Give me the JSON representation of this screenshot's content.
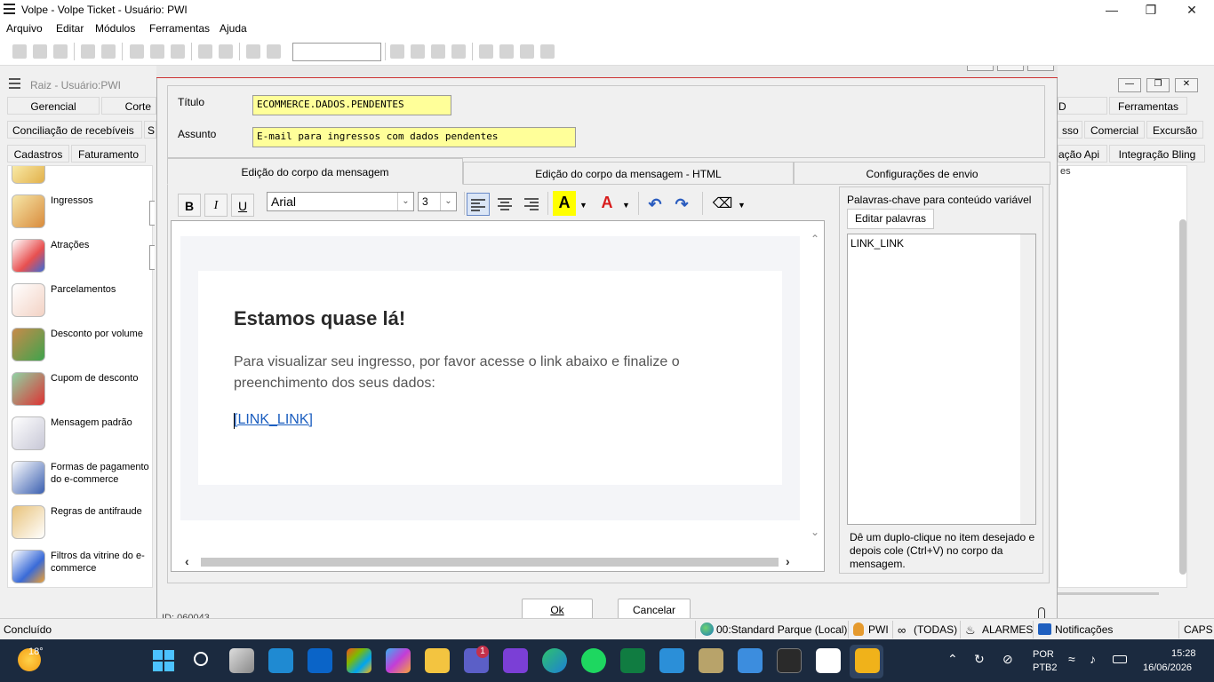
{
  "window": {
    "title": "Volpe - Volpe Ticket - Usuário: PWI"
  },
  "menu": [
    "Arquivo",
    "Editar",
    "Módulos",
    "Ferramentas",
    "Ajuda"
  ],
  "bgwindow": {
    "title": "Raiz - Usuário:PWI",
    "tabs_row1": [
      "Gerencial",
      "Corte",
      "D",
      "Ferramentas"
    ],
    "tabs_row2": [
      "Conciliação de recebíveis",
      "S",
      "sso",
      "Comercial",
      "Excursão"
    ],
    "tabs_row3": [
      "Cadastros",
      "Faturamento",
      "ação Api",
      "Integração Bling"
    ],
    "list": [
      "Ingressos",
      "Atrações",
      "Parcelamentos",
      "Desconto por volume",
      "Cupom de desconto",
      "Mensagem padrão",
      "Formas de pagamento do e-commerce",
      "Regras de antifraude",
      "Filtros da vitrine do e-commerce"
    ],
    "right_text": "es"
  },
  "dialog": {
    "titulo_label": "Título",
    "titulo_value": "ECOMMERCE.DADOS.PENDENTES",
    "assunto_label": "Assunto",
    "assunto_value": "E-mail para ingressos com dados pendentes",
    "tabs": [
      "Edição do corpo da mensagem",
      "Edição do corpo da mensagem - HTML",
      "Configurações de envio"
    ],
    "toolbar": {
      "bold": "B",
      "italic": "I",
      "underline": "U",
      "font": "Arial",
      "size": "3",
      "highlight": "A",
      "fontcolor": "A"
    },
    "email": {
      "heading": "Estamos quase lá!",
      "paragraph": "Para visualizar seu ingresso, por favor acesse o link abaixo e finalize o preenchimento dos seus dados:",
      "link": "[LINK_LINK]"
    },
    "keywords": {
      "title": "Palavras-chave para conteúdo variável",
      "edit_button": "Editar palavras",
      "items": [
        "LINK_LINK"
      ],
      "hint": "Dê um duplo-clique no item desejado e depois cole (Ctrl+V) no corpo da mensagem."
    },
    "ok": "Ok",
    "cancel": "Cancelar",
    "id_text": "ID: 060043"
  },
  "status": {
    "left": "Concluído",
    "connection": "00:Standard Parque (Local)",
    "user": "PWI",
    "scope": "(TODAS)",
    "alarms": "ALARMES",
    "notifications": "Notificações",
    "caps": "CAPS"
  },
  "taskbar": {
    "weather": "18°",
    "lang1": "POR",
    "lang2": "PTB2",
    "time": "15:28",
    "date": "16/06/2026",
    "teams_badge": "1"
  },
  "colors": {
    "accent": "#1a5dbf",
    "highlight_field": "#ffff99",
    "taskbar": "#1b2a3f"
  }
}
